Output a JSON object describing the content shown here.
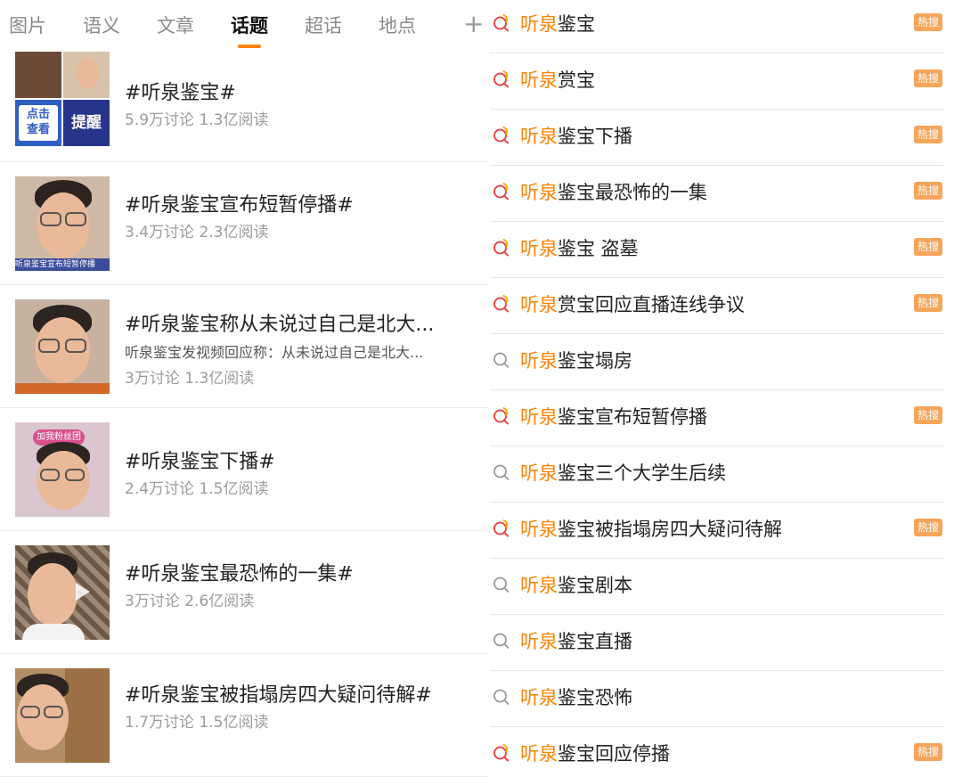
{
  "tabs": {
    "items": [
      {
        "label": "图片"
      },
      {
        "label": "语义"
      },
      {
        "label": "文章"
      },
      {
        "label": "话题"
      },
      {
        "label": "超话"
      },
      {
        "label": "地点"
      }
    ],
    "active": "话题",
    "more_label": "+"
  },
  "topics": [
    {
      "title": "#听泉鉴宝#",
      "meta": "5.9万讨论 1.3亿阅读",
      "thumb_text": [
        "点击",
        "查看",
        "提醒"
      ]
    },
    {
      "title": "#听泉鉴宝宣布短暂停播#",
      "meta": "3.4万讨论 2.3亿阅读",
      "thumb_text": [
        "听泉鉴宝宣布短暂停播"
      ]
    },
    {
      "title": "#听泉鉴宝称从未说过自己是北大...",
      "desc": "听泉鉴宝发视频回应称：从未说过自己是北大...",
      "meta": "3万讨论 1.3亿阅读"
    },
    {
      "title": "#听泉鉴宝下播#",
      "meta": "2.4万讨论 1.5亿阅读",
      "thumb_text": [
        "加我粉丝团"
      ]
    },
    {
      "title": "#听泉鉴宝最恐怖的一集#",
      "meta": "3万讨论 2.6亿阅读"
    },
    {
      "title": "#听泉鉴宝被指塌房四大疑问待解#",
      "meta": "1.7万讨论 1.5亿阅读"
    }
  ],
  "suggestions": {
    "highlight": "听泉",
    "hot_label": "热搜",
    "accent_color": "#ff8200",
    "items": [
      {
        "rest": "鉴宝",
        "hot": true
      },
      {
        "rest": "赏宝",
        "hot": true
      },
      {
        "rest": "鉴宝下播",
        "hot": true
      },
      {
        "rest": "鉴宝最恐怖的一集",
        "hot": true
      },
      {
        "rest": "鉴宝 盗墓",
        "hot": true
      },
      {
        "rest": "赏宝回应直播连线争议",
        "hot": true
      },
      {
        "rest": "鉴宝塌房",
        "hot": false
      },
      {
        "rest": "鉴宝宣布短暂停播",
        "hot": true
      },
      {
        "rest": "鉴宝三个大学生后续",
        "hot": false
      },
      {
        "rest": "鉴宝被指塌房四大疑问待解",
        "hot": true
      },
      {
        "rest": "鉴宝剧本",
        "hot": false
      },
      {
        "rest": "鉴宝直播",
        "hot": false
      },
      {
        "rest": "鉴宝恐怖",
        "hot": false
      },
      {
        "rest": "鉴宝回应停播",
        "hot": true
      }
    ]
  }
}
